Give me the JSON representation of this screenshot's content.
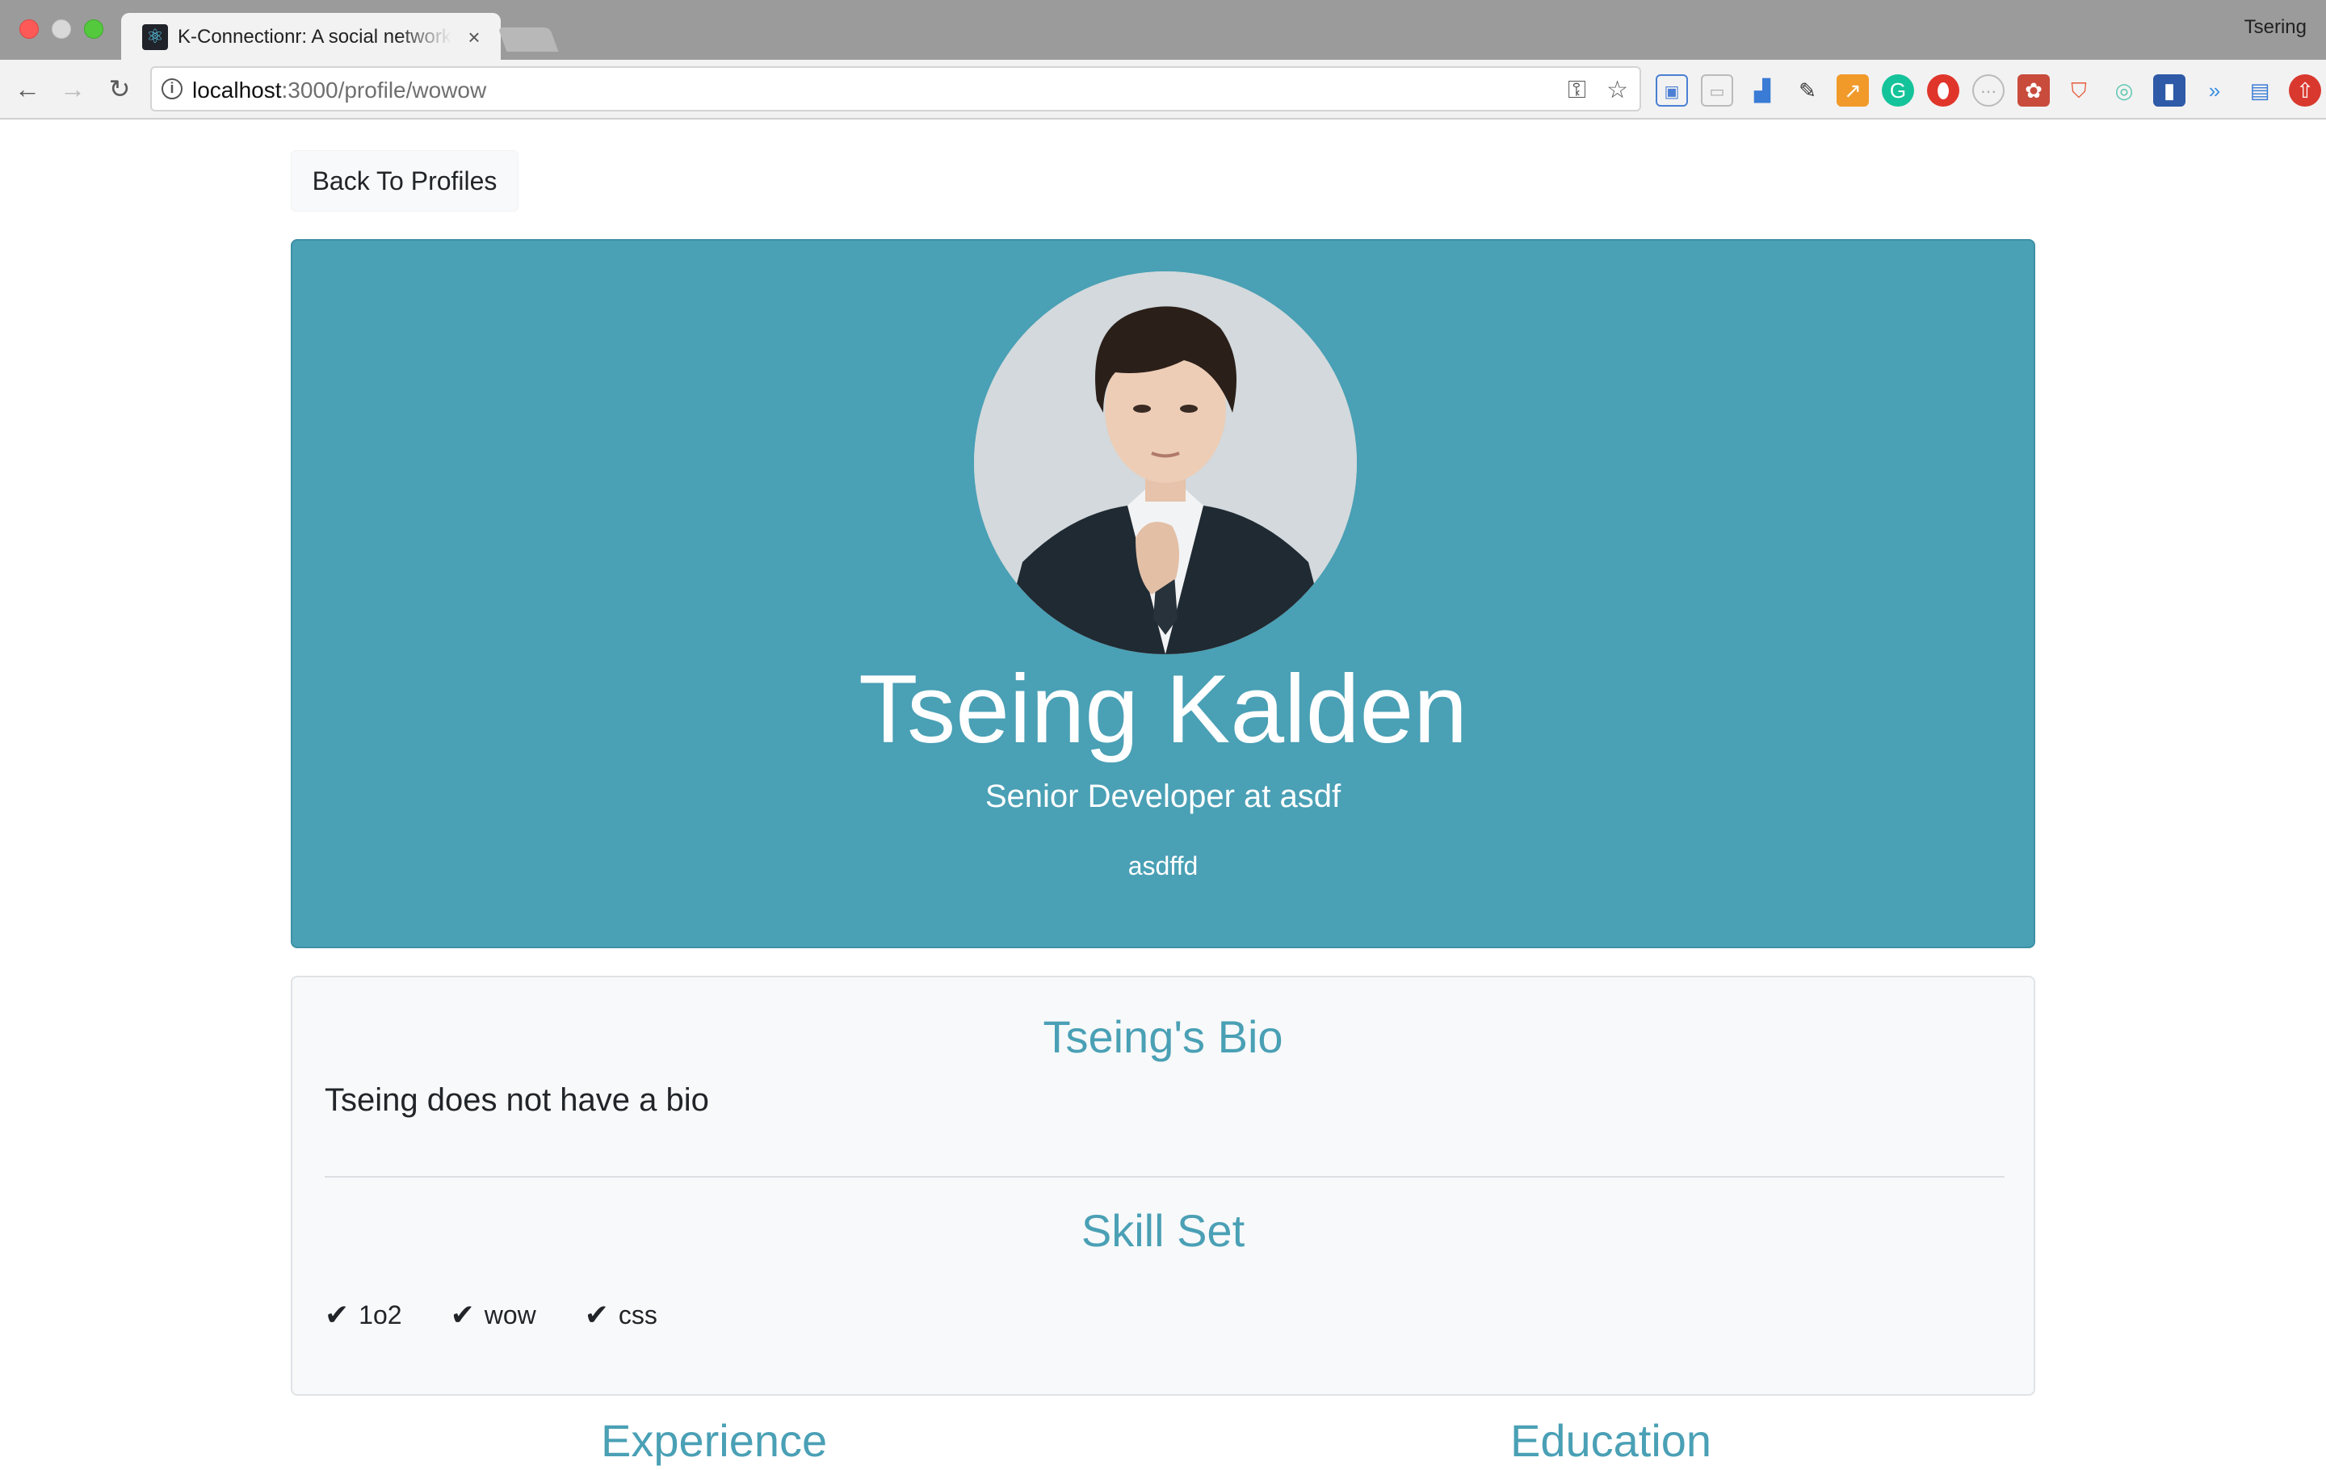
{
  "browser": {
    "tab_title": "K-Connectionr: A social network",
    "tab_close": "×",
    "profile_name": "Tsering",
    "url_host": "localhost",
    "url_path": ":3000/profile/wowow",
    "icons": {
      "back": "←",
      "forward": "→",
      "reload": "↻",
      "info": "i",
      "key": "⚿",
      "star": "☆"
    }
  },
  "page": {
    "back_button": "Back To Profiles",
    "profile": {
      "name": "Tseing Kalden",
      "job": "Senior Developer at asdf",
      "location": "asdffd"
    },
    "bio": {
      "heading": "Tseing's Bio",
      "text": "Tseing does not have a bio"
    },
    "skills": {
      "heading": "Skill Set",
      "items": [
        "1o2",
        "wow",
        "css"
      ]
    },
    "sections": {
      "experience": "Experience",
      "education": "Education"
    }
  },
  "colors": {
    "hero_bg": "#4aa0b5",
    "accent_text": "#4aa0b5",
    "card_bg": "#f8f9fa"
  }
}
